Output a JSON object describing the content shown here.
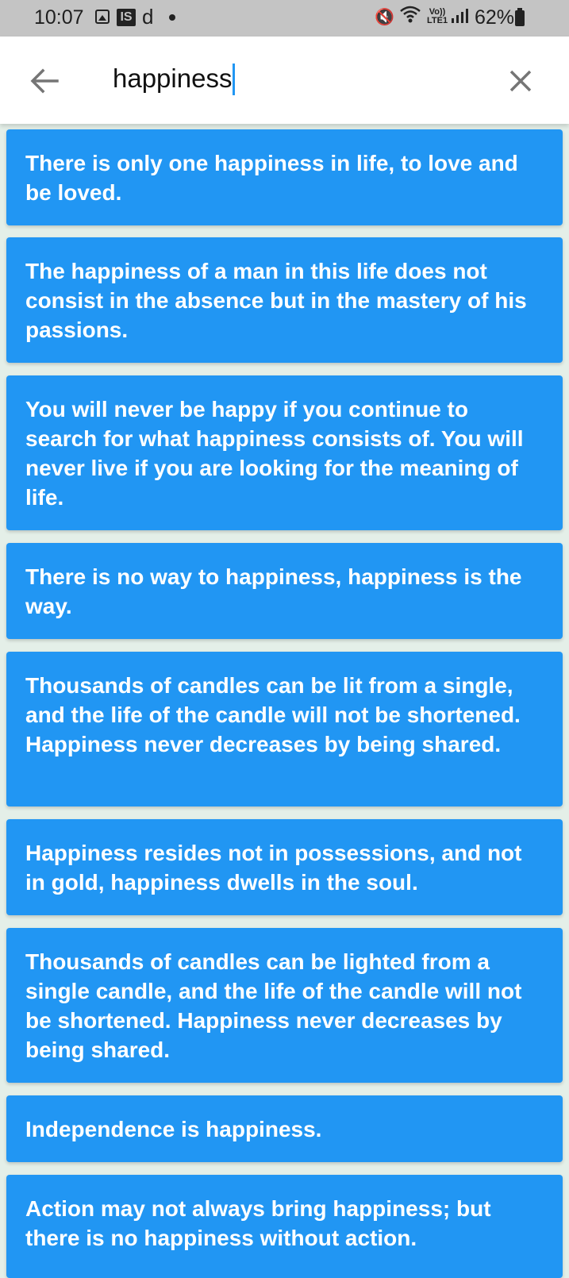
{
  "status_bar": {
    "time": "10:07",
    "notification_letter": "d",
    "is_badge": "IS",
    "volte_line1": "Vo))",
    "volte_line2": "LTE1",
    "battery": "62%"
  },
  "search": {
    "query": "happiness",
    "back_icon": "arrow-back-icon",
    "clear_icon": "close-icon"
  },
  "colors": {
    "card_background": "#2196f3",
    "card_text": "#ffffff",
    "page_background": "#e4efe8",
    "caret": "#2196f3"
  },
  "quotes": [
    "There is only one happiness in life, to love and be loved.",
    "The happiness of a man in this life does not consist in the absence but in the mastery of his passions.",
    "You will never be happy if you continue to search for what happiness consists of. You will never live if you are looking for the meaning of life.",
    "There is no way to happiness, happiness is the way.",
    "Thousands of candles can be lit from a single, and the life of the candle will not be shortened. Happiness never decreases by being shared.",
    "Happiness resides not in possessions, and not in gold, happiness dwells in the soul.",
    "Thousands of candles can be lighted from a single candle, and the life of the candle will not be shortened. Happiness never decreases by being shared.",
    "Independence is happiness.",
    "Action may not always bring happiness; but there is no happiness without action."
  ]
}
